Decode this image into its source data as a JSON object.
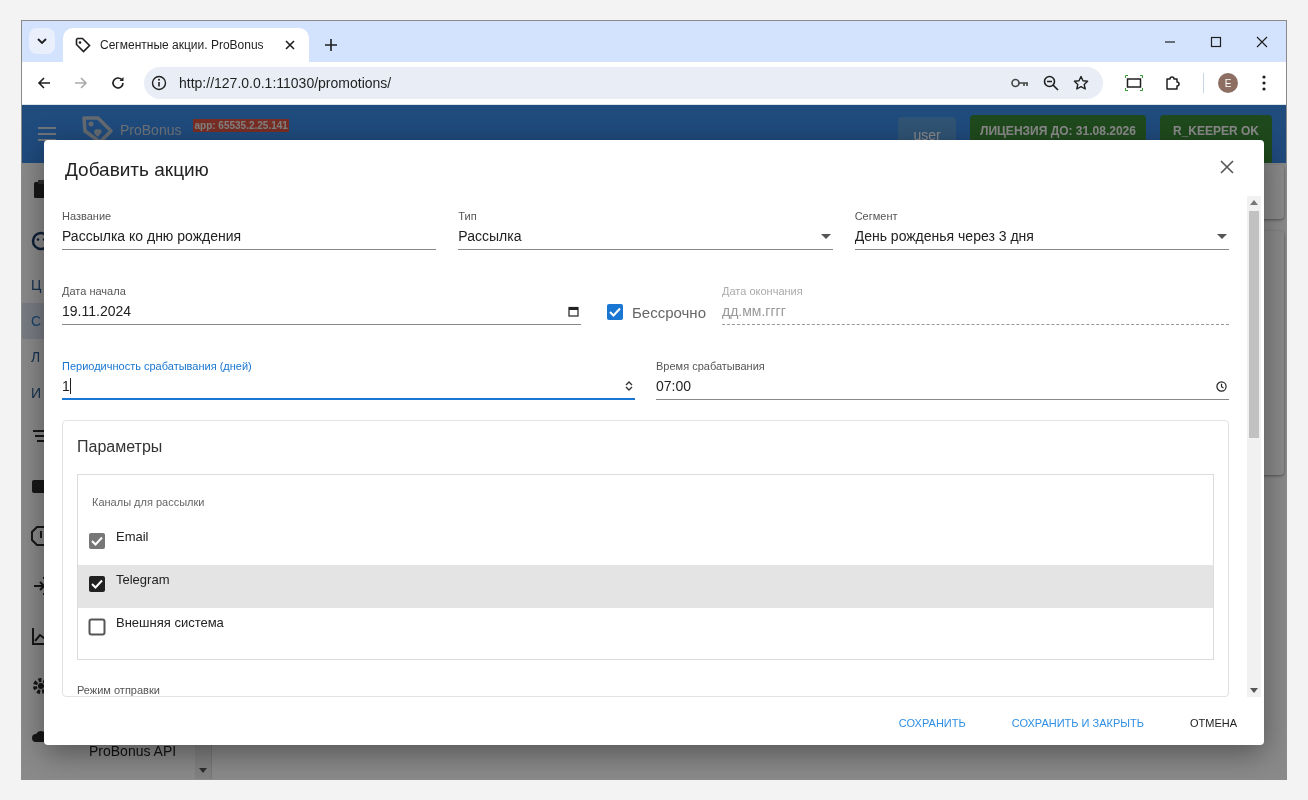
{
  "browser": {
    "tabs": [
      {
        "title": "Сегментные акции. ProBonus",
        "selected": true
      }
    ],
    "back_enabled": true,
    "forward_enabled": false,
    "url": "http://127.0.0.1:11030/promotions/",
    "profile_initial": "E"
  },
  "app": {
    "brand": "ProBonus",
    "version_badge": "app: 65535.2.25.141",
    "user_button": "user",
    "license_button": "ЛИЦЕНЗИЯ ДО: 31.08.2026",
    "status_button": "R_KEEPER OK",
    "sidebar": {
      "items": [
        {
          "kind": "icon"
        },
        {
          "kind": "icon"
        },
        {
          "kind": "link",
          "label": "Ц",
          "selected": false
        },
        {
          "kind": "link",
          "label": "С",
          "selected": true
        },
        {
          "kind": "link",
          "label": "Л",
          "selected": false
        },
        {
          "kind": "link",
          "label": "И",
          "selected": false
        },
        {
          "kind": "icon"
        },
        {
          "kind": "icon"
        },
        {
          "kind": "icon"
        },
        {
          "kind": "icon"
        },
        {
          "kind": "icon"
        },
        {
          "kind": "icon"
        },
        {
          "kind": "icon",
          "label": "ProBonus API"
        }
      ]
    }
  },
  "dialog": {
    "title": "Добавить акцию",
    "rows": [
      [
        {
          "kind": "text",
          "label": "Название",
          "value": "Рассылка ко дню рождения"
        },
        {
          "kind": "select",
          "label": "Тип",
          "value": "Рассылка"
        },
        {
          "kind": "select",
          "label": "Сегмент",
          "value": "День рожденья через 3 дня"
        }
      ],
      [
        {
          "kind": "date",
          "label": "Дата начала",
          "value": "19.11.2024"
        },
        {
          "kind": "checkbox",
          "label": "Бессрочно",
          "checked": true
        },
        {
          "kind": "date",
          "label": "Дата окончания",
          "placeholder": "дд.мм.гггг",
          "disabled": true
        }
      ],
      [
        {
          "kind": "number",
          "label": "Периодичность срабатывания (дней)",
          "value": "1",
          "focused": true
        },
        {
          "kind": "time",
          "label": "Время срабатывания",
          "value": "07:00"
        }
      ]
    ],
    "parameters": {
      "title": "Параметры",
      "channels_label": "Каналы для рассылки",
      "channels": [
        {
          "label": "Email",
          "checked": true,
          "disabled": true,
          "highlighted": false
        },
        {
          "label": "Telegram",
          "checked": true,
          "disabled": false,
          "highlighted": true
        },
        {
          "label": "Внешняя система",
          "checked": false,
          "disabled": false,
          "highlighted": false
        }
      ],
      "send_mode_label": "Режим отправки"
    },
    "buttons": [
      {
        "label": "СОХРАНИТЬ",
        "kind": "primary"
      },
      {
        "label": "СОХРАНИТЬ И ЗАКРЫТЬ",
        "kind": "primary"
      },
      {
        "label": "ОТМЕНА",
        "kind": "plain"
      }
    ]
  }
}
